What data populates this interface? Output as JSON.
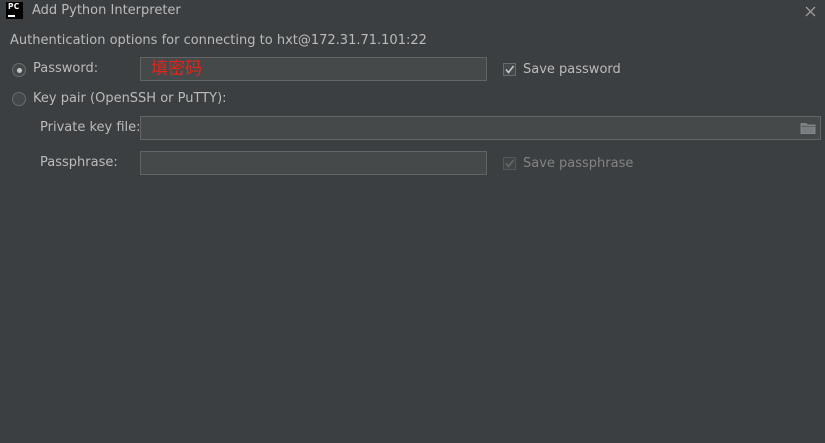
{
  "window": {
    "logo_text": "PC",
    "title": "Add Python Interpreter"
  },
  "auth": {
    "description": "Authentication options for connecting to hxt@172.31.71.101:22",
    "password_option": {
      "label": "Password:",
      "selected": true,
      "value_annotation": "填密码",
      "save_label": "Save password",
      "save_checked": true
    },
    "keypair_option": {
      "label": "Key pair (OpenSSH or PuTTY):",
      "selected": false,
      "private_key_label": "Private key file:",
      "private_key_value": "",
      "passphrase_label": "Passphrase:",
      "passphrase_value": "",
      "save_passphrase_label": "Save passphrase",
      "save_passphrase_checked": true,
      "save_passphrase_enabled": false
    }
  },
  "colors": {
    "background": "#3c3f41",
    "text": "#bbbbbb",
    "field_bg": "#45494a",
    "field_border": "#646464",
    "annotation_red": "#e0261a"
  },
  "icons": {
    "app": "pycharm-logo-icon",
    "close": "close-icon",
    "browse": "folder-icon"
  }
}
